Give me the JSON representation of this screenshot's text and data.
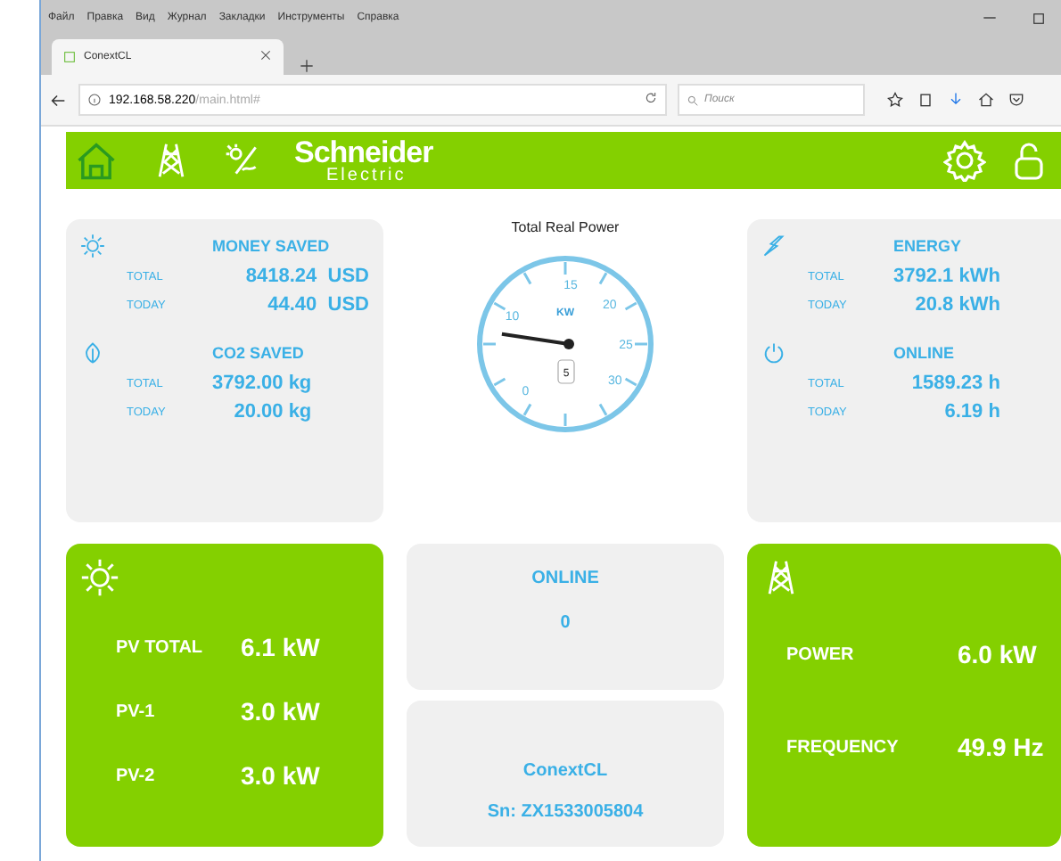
{
  "menu": [
    "Файл",
    "Правка",
    "Вид",
    "Журнал",
    "Закладки",
    "Инструменты",
    "Справка"
  ],
  "tab": {
    "title": "ConextCL",
    "selected": true
  },
  "address": {
    "host": "192.168.58.220",
    "path": "/main.html#"
  },
  "search": {
    "placeholder": "Поиск"
  },
  "header": {
    "logo_top": "Schneider",
    "logo_bottom": "Electric"
  },
  "savings": [
    {
      "title": "MONEY SAVED",
      "rows": [
        {
          "label": "TOTAL",
          "value": "8418.24",
          "unit": "USD"
        },
        {
          "label": "TODAY",
          "value": "44.40",
          "unit": "USD"
        }
      ]
    },
    {
      "title": "CO2 SAVED",
      "rows": [
        {
          "label": "TOTAL",
          "value": "3792.00 kg"
        },
        {
          "label": "TODAY",
          "value": "20.00 kg"
        }
      ]
    }
  ],
  "gauge": {
    "title": "Total Real Power",
    "unit": "KW",
    "labels": [
      "0",
      "10",
      "15",
      "20",
      "25",
      "30"
    ],
    "reading": "5"
  },
  "stats": [
    {
      "title": "ENERGY",
      "rows": [
        {
          "label": "TOTAL",
          "value": "3792.1 kWh"
        },
        {
          "label": "TODAY",
          "value": "20.8 kWh"
        }
      ]
    },
    {
      "title": "ONLINE",
      "rows": [
        {
          "label": "TOTAL",
          "value": "1589.23 h"
        },
        {
          "label": "TODAY",
          "value": "6.19 h"
        }
      ]
    }
  ],
  "pv": {
    "rows": [
      {
        "label": "PV TOTAL",
        "value": "6.1 kW"
      },
      {
        "label": "PV-1",
        "value": "3.0 kW"
      },
      {
        "label": "PV-2",
        "value": "3.0 kW"
      }
    ]
  },
  "online": {
    "title": "ONLINE",
    "value": "0"
  },
  "device": {
    "name": "ConextCL",
    "serial": "Sn: ZX1533005804"
  },
  "grid": {
    "rows": [
      {
        "label": "POWER",
        "value": "6.0 kW"
      },
      {
        "label": "FREQUENCY",
        "value": "49.9 Hz"
      }
    ]
  }
}
